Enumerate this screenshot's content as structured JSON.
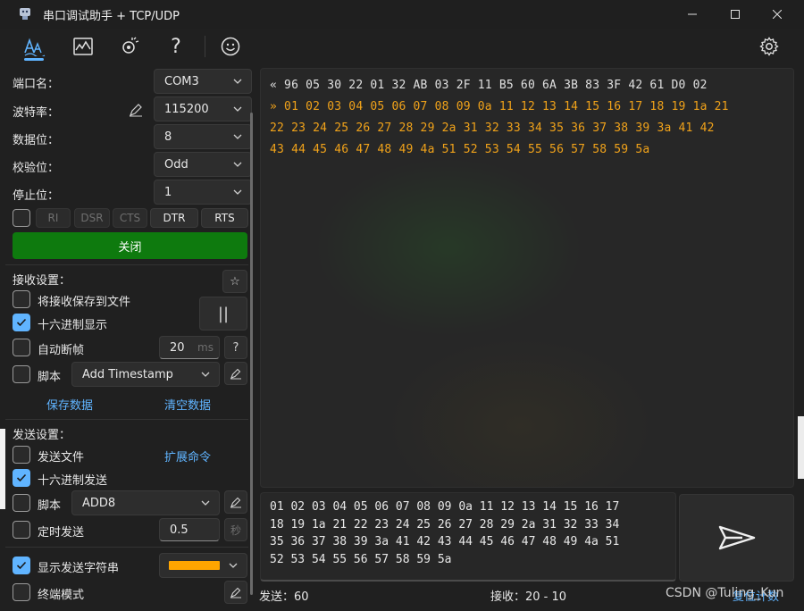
{
  "window": {
    "title": "串口调试助手 + TCP/UDP",
    "minimize_icon": "minimize-icon",
    "maximize_icon": "maximize-icon",
    "close_icon": "close-icon"
  },
  "toolbar": {
    "items": [
      "serial-wave-icon",
      "chart-icon",
      "plugin-icon",
      "help-icon",
      "smiley-icon"
    ],
    "help_glyph": "?",
    "settings_icon": "gear-icon"
  },
  "port": {
    "port_label": "端口名：",
    "port_value": "COM3",
    "baud_label": "波特率：",
    "baud_value": "115200",
    "databits_label": "数据位：",
    "databits_value": "8",
    "parity_label": "校验位：",
    "parity_value": "Odd",
    "stopbits_label": "停止位：",
    "stopbits_value": "1",
    "signals": [
      "RI",
      "DSR",
      "CTS",
      "DTR",
      "RTS"
    ],
    "close_button": "关闭"
  },
  "receive_settings": {
    "heading": "接收设置：",
    "save_to_file": "将接收保存到文件",
    "hex_display": "十六进制显示",
    "auto_frame": "自动断帧",
    "auto_frame_value": "20",
    "auto_frame_unit": "ms",
    "help_glyph": "?",
    "script_label": "脚本",
    "script_value": "Add Timestamp",
    "pause_glyph": "||",
    "star_glyph": "☆",
    "save_data": "保存数据",
    "clear_data": "清空数据"
  },
  "send_settings": {
    "heading": "发送设置：",
    "send_file": "发送文件",
    "extend_cmd": "扩展命令",
    "hex_send": "十六进制发送",
    "script_label": "脚本",
    "script_value": "ADD8",
    "timed_send": "定时发送",
    "timed_value": "0.5",
    "timed_unit": "秒",
    "show_send_string": "显示发送字符串",
    "show_send_color": "#ffa500",
    "terminal_mode": "终端模式"
  },
  "receive_area": {
    "rx_line": "« 96 05 30 22 01 32 AB 03 2F 11 B5 60 6A 3B 83 3F 42 61 D0 02",
    "tx_lines": [
      "» 01 02 03 04 05 06 07 08 09 0a 11 12 13 14 15 16 17 18 19 1a 21",
      "22 23 24 25 26 27 28 29 2a 31 32 33 34 35 36 37 38 39 3a 41 42",
      "43 44 45 46 47 48 49 4a 51 52 53 54 55 56 57 58 59 5a"
    ],
    "colors": {
      "rx": "#e0e0e0",
      "tx": "#f0a21a"
    }
  },
  "send_area": {
    "text": "01 02 03 04 05 06 07 08 09 0a 11 12 13 14 15 16 17\n18 19 1a 21 22 23 24 25 26 27 28 29 2a 31 32 33 34\n35 36 37 38 39 3a 41 42 43 44 45 46 47 48 49 4a 51\n52 53 54 55 56 57 58 59 5a",
    "send_icon": "send-icon"
  },
  "status_bar": {
    "sent": "发送：60",
    "received": "接收：20 - 10",
    "reset": "复位计数"
  },
  "watermark": "CSDN @Tuling_Kun",
  "colors": {
    "accent": "#60b4ff",
    "connect_green": "#0e7a0e",
    "background": "#202020"
  }
}
